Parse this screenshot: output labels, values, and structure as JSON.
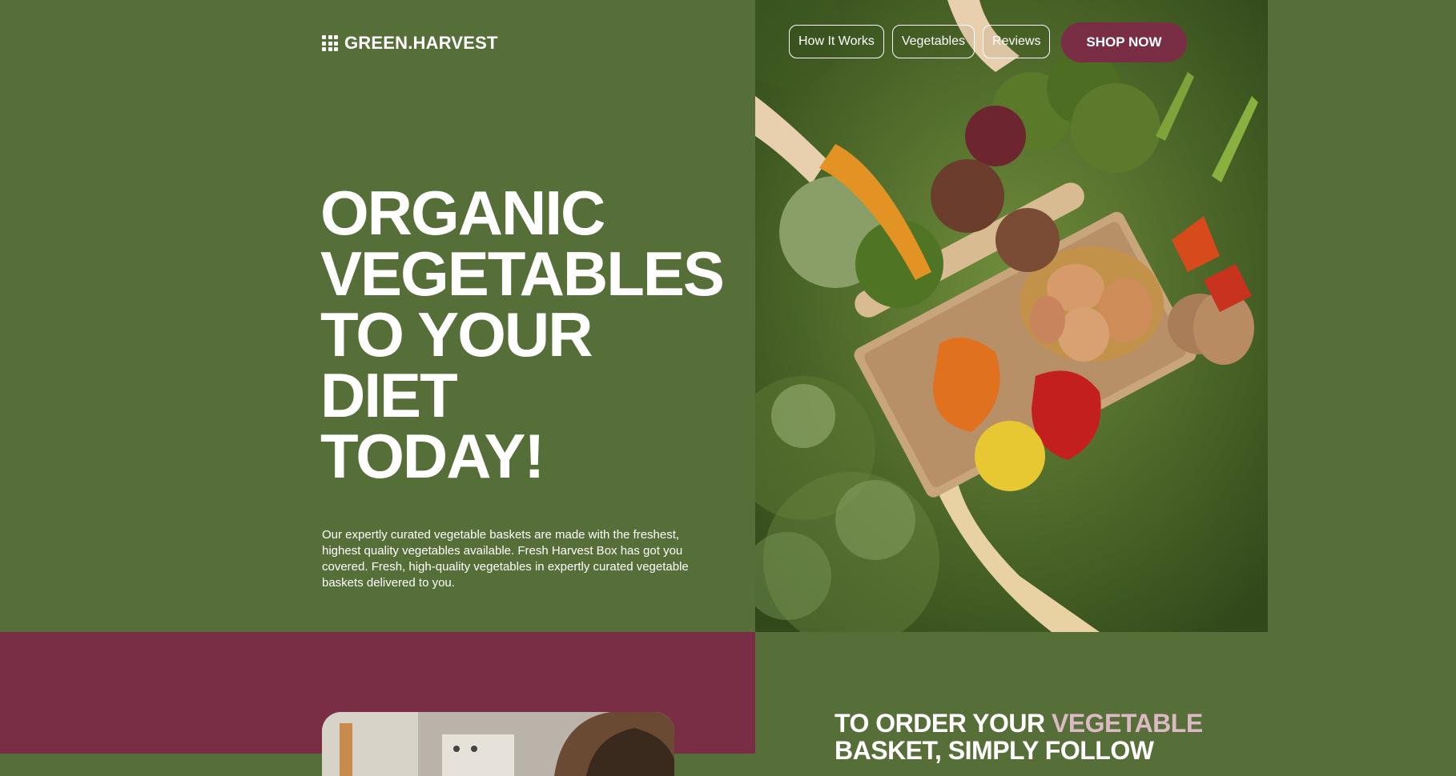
{
  "brand": {
    "name": "GREEN.HARVEST",
    "icon": "grid-icon"
  },
  "nav": {
    "items": [
      {
        "label": "How It Works"
      },
      {
        "label": "Vegetables"
      },
      {
        "label": "Reviews"
      }
    ],
    "cta_label": "SHOP NOW"
  },
  "hero": {
    "headline_lines": [
      "ORGANIC",
      "VEGETABLES",
      "TO YOUR DIET",
      "TODAY!"
    ],
    "description": "Our expertly curated vegetable baskets are made with the freshest, highest quality vegetables available. Fresh Harvest Box has got you covered. Fresh, high-quality vegetables in expertly curated vegetable baskets delivered to you."
  },
  "order_section": {
    "heading_part1": "TO ORDER YOUR ",
    "heading_accent": "VEGETABLE",
    "heading_part2": "BASKET, SIMPLY FOLLOW"
  },
  "colors": {
    "green": "#566e37",
    "maroon": "#7a2e45",
    "accent_pink": "#dcb9c4",
    "white": "#ffffff"
  }
}
